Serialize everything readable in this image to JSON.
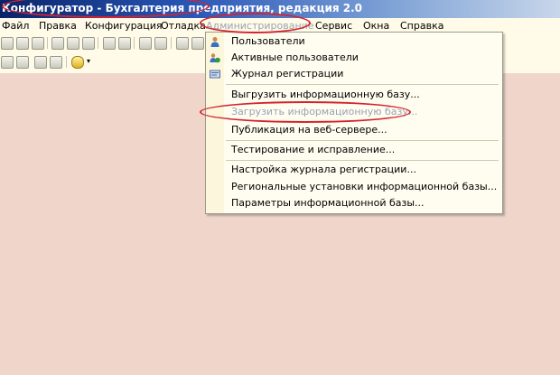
{
  "window": {
    "title": "Конфигуратор - Бухгалтерия предприятия, редакция 2.0"
  },
  "menubar": {
    "items": [
      {
        "label": "Файл"
      },
      {
        "label": "Правка"
      },
      {
        "label": "Конфигурация"
      },
      {
        "label": "Отладка"
      },
      {
        "label": "Администрирование"
      },
      {
        "label": "Сервис"
      },
      {
        "label": "Окна"
      },
      {
        "label": "Справка"
      }
    ],
    "open_menu": "Администрирование"
  },
  "admin_menu": {
    "items": [
      {
        "label": "Пользователи",
        "icon": "user-icon"
      },
      {
        "label": "Активные пользователи",
        "icon": "active-users-icon"
      },
      {
        "label": "Журнал регистрации",
        "icon": "log-icon"
      },
      {
        "label": "Выгрузить информационную базу..."
      },
      {
        "label": "Загрузить информационную базу...",
        "state": "highlighted"
      },
      {
        "label": "Публикация на веб-сервере..."
      },
      {
        "label": "Тестирование и исправление..."
      },
      {
        "label": "Настройка журнала регистрации..."
      },
      {
        "label": "Региональные установки информационной базы..."
      },
      {
        "label": "Параметры информационной базы..."
      }
    ]
  },
  "colors": {
    "annotation_red": "#d4232e",
    "workspace": "#efd5ca",
    "menu_background": "#fffbe8"
  }
}
